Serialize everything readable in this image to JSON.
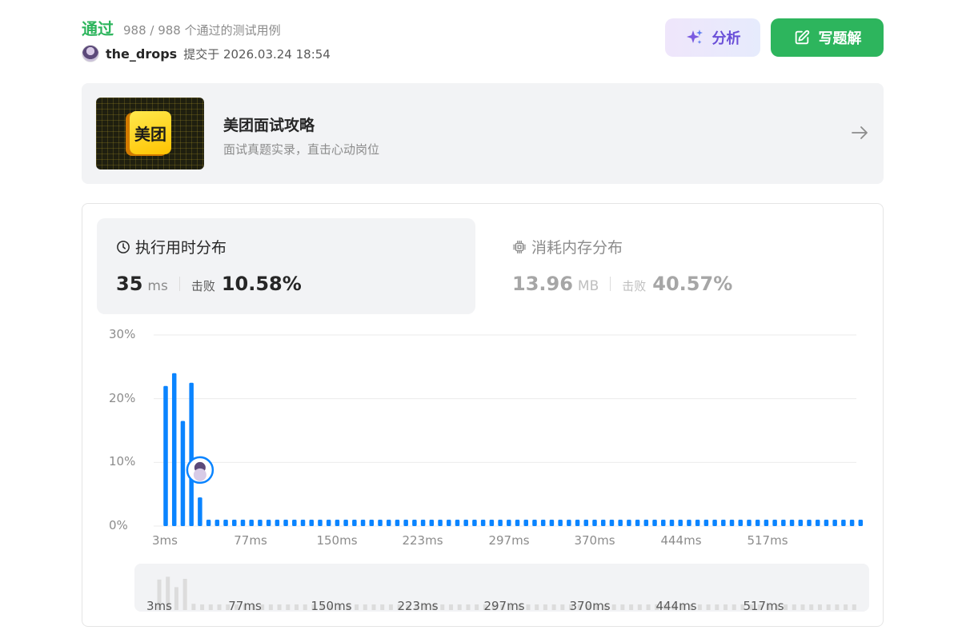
{
  "header": {
    "status": "通过",
    "cases": "988 / 988 个通过的测试用例",
    "username": "the_drops",
    "submitted": "提交于 2026.03.24 18:54"
  },
  "buttons": {
    "analyze": "分析",
    "write_solution": "写题解"
  },
  "promo": {
    "logo_text": "美团",
    "title": "美团面试攻略",
    "subtitle": "面试真题实录，直击心动岗位"
  },
  "runtime": {
    "title": "执行用时分布",
    "value": "35",
    "unit": "ms",
    "beat_label": "击败",
    "beat_value": "10.58%"
  },
  "memory": {
    "title": "消耗内存分布",
    "value": "13.96",
    "unit": "MB",
    "beat_label": "击败",
    "beat_value": "40.57%"
  },
  "colors": {
    "accent_green": "#2db55d",
    "bar_blue": "#0a84ff",
    "analyze_purple": "#6a4fd8"
  },
  "chart_data": {
    "type": "bar",
    "ylim": [
      0,
      30
    ],
    "yticks": [
      "0%",
      "10%",
      "20%",
      "30%"
    ],
    "xticks": [
      "3ms",
      "77ms",
      "150ms",
      "223ms",
      "297ms",
      "370ms",
      "444ms",
      "517ms"
    ],
    "values": [
      22.0,
      24.0,
      16.5,
      22.5,
      4.5,
      1.0,
      1.0,
      1.0,
      1.0,
      1.0,
      1.0,
      1.0,
      1.0,
      1.0,
      1.0,
      1.0,
      1.0,
      1.0,
      1.0,
      1.0,
      1.0,
      1.0,
      1.0,
      1.0,
      1.0,
      1.0,
      1.0,
      1.0,
      1.0,
      1.0,
      1.0,
      1.0,
      1.0,
      1.0,
      1.0,
      1.0,
      1.0,
      1.0,
      1.0,
      1.0,
      1.0,
      1.0,
      1.0,
      1.0,
      1.0,
      1.0,
      1.0,
      1.0,
      1.0,
      1.0,
      1.0,
      1.0,
      1.0,
      1.0,
      1.0,
      1.0,
      1.0,
      1.0,
      1.0,
      1.0,
      1.0,
      1.0,
      1.0,
      1.0,
      1.0,
      1.0,
      1.0,
      1.0,
      1.0,
      1.0,
      1.0,
      1.0,
      1.0,
      1.0,
      1.0,
      1.0,
      1.0,
      1.0,
      1.0,
      1.0,
      1.0,
      1.0
    ],
    "user_marker_value": 8.8,
    "mini_xticks": [
      "3ms",
      "77ms",
      "150ms",
      "223ms",
      "297ms",
      "370ms",
      "444ms",
      "517ms"
    ]
  }
}
